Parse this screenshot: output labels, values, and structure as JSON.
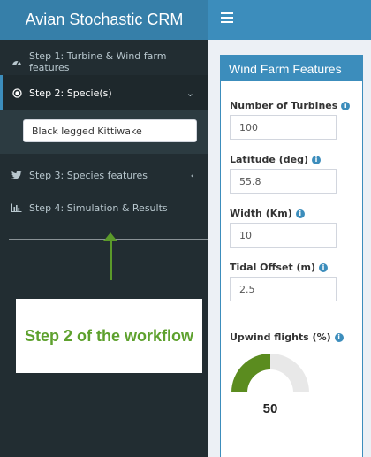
{
  "header": {
    "app_title": "Avian Stochastic CRM",
    "menu_toggle_icon": "hamburger-icon"
  },
  "sidebar": {
    "items": [
      {
        "label": "Step 1: Turbine & Wind farm features",
        "icon": "tachometer-icon"
      },
      {
        "label": "Step 2: Specie(s)",
        "icon": "dot-circle-icon",
        "active": true,
        "caret": "⌄"
      },
      {
        "label": "Step 3: Species features",
        "icon": "twitter-bird-icon",
        "caret": "‹"
      },
      {
        "label": "Step 4: Simulation & Results",
        "icon": "bar-chart-icon"
      }
    ],
    "species_value": "Black legged Kittiwake"
  },
  "annotation": {
    "callout_text": "Step 2 of the workflow",
    "arrow_color": "#5b9a2a",
    "text_color": "#5ea12e"
  },
  "main": {
    "box_title": "Wind Farm Features",
    "fields": [
      {
        "label": "Number of Turbines",
        "value": "100"
      },
      {
        "label": "Latitude (deg)",
        "value": "55.8"
      },
      {
        "label": "Width (Km)",
        "value": "10"
      },
      {
        "label": "Tidal Offset (m)",
        "value": "2.5"
      }
    ],
    "upwind": {
      "label": "Upwind flights (%)",
      "value": "50",
      "fraction": 0.5
    }
  },
  "colors": {
    "header": "#3c8dbc",
    "header_logo": "#367fa9",
    "sidebar": "#222d32",
    "gauge_fill": "#5b8c1f",
    "gauge_track": "#e8e8e8"
  }
}
